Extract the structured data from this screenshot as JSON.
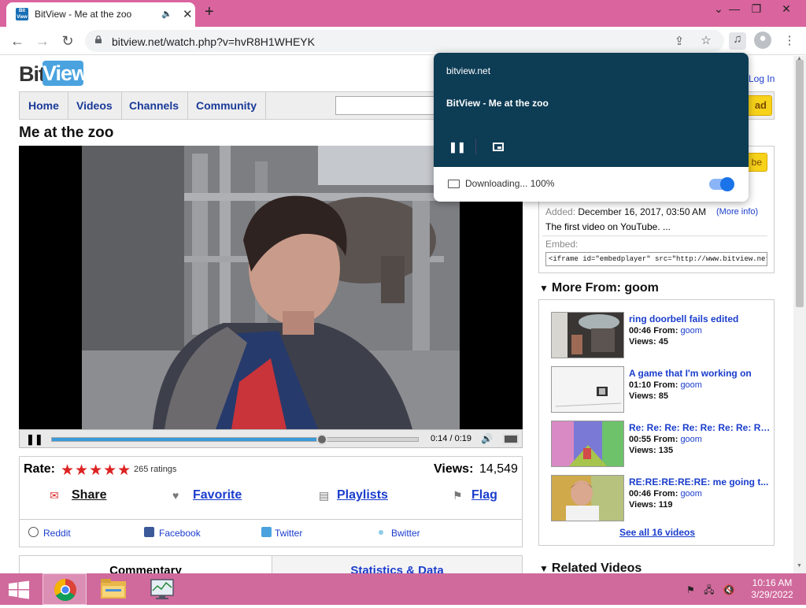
{
  "browser": {
    "tab_title": "BitView - Me at the zoo",
    "favicon_text": "Bit View",
    "url": "bitview.net/watch.php?v=hvR8H1WHEYK",
    "new_tab_label": "+",
    "window_controls": [
      "minimize",
      "restore",
      "close"
    ]
  },
  "site": {
    "logo_bit": "Bit",
    "logo_view": "View",
    "login": "Log In",
    "nav": [
      "Home",
      "Videos",
      "Channels",
      "Community"
    ],
    "upload_label": "ad"
  },
  "video": {
    "title": "Me at the zoo",
    "current_time": "0:14",
    "duration": "0:19",
    "time_sep": " / ",
    "progress_fraction": 0.737
  },
  "rating": {
    "label": "Rate:",
    "stars": "★★★★★",
    "count": "265 ratings",
    "views_label": "Views:",
    "views": "14,549"
  },
  "actions": [
    "Share",
    "Favorite",
    "Playlists",
    "Flag"
  ],
  "social": [
    "Reddit",
    "Facebook",
    "Twitter",
    "Bwitter"
  ],
  "bottom_tabs": [
    "Commentary",
    "Statistics & Data"
  ],
  "info": {
    "subscribe_label": "be",
    "added_label": "Added:",
    "added_value": "December 16, 2017, 03:50 AM",
    "more_info": "(More info)",
    "description": "The first video on YouTube. ...",
    "embed_label": "Embed:",
    "embed_code": "<iframe id=\"embedplayer\" src=\"http://www.bitview.net/embed.php"
  },
  "more_from": {
    "heading": "More From: goom",
    "items": [
      {
        "title": "ring doorbell fails edited",
        "duration": "00:46",
        "from_label": "From:",
        "user": "goom",
        "views": "Views: 45"
      },
      {
        "title": "A game that I'm working on",
        "duration": "01:10",
        "from_label": "From:",
        "user": "goom",
        "views": "Views: 85"
      },
      {
        "title": "Re: Re: Re: Re: Re: Re: Re: Re: R...",
        "duration": "00:55",
        "from_label": "From:",
        "user": "goom",
        "views": "Views: 135"
      },
      {
        "title": "RE:RE:RE:RE:RE: me going t...",
        "duration": "00:46",
        "from_label": "From:",
        "user": "goom",
        "views": "Views: 119"
      }
    ],
    "see_all": "See all 16 videos"
  },
  "related_heading": "Related Videos",
  "media_popup": {
    "site": "bitview.net",
    "title": "BitView - Me at the zoo",
    "download_status": "Downloading... 100%",
    "toggle_on": true
  },
  "taskbar": {
    "time": "10:16 AM",
    "date": "3/29/2022"
  },
  "colors": {
    "titlebar": "#d9649e",
    "taskbar": "#d06a9c",
    "popup": "#0d3c55",
    "link": "#1a3dcc",
    "upload": "#f7d21a"
  }
}
